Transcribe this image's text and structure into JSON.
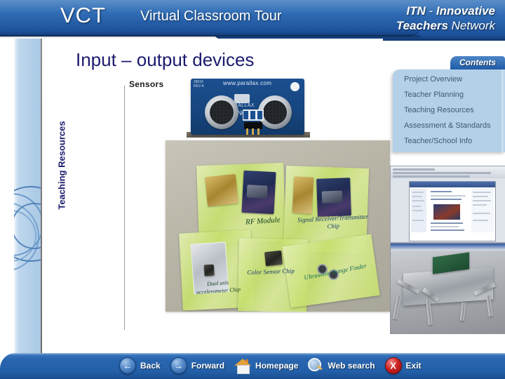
{
  "header": {
    "logo_abbrev": "VCT",
    "logo_full": "Virtual Classroom Tour",
    "brand_line1_bold": "ITN",
    "brand_line1_rest": " - ",
    "brand_line1_italic": "Innovative",
    "brand_line2_bold": "Teachers",
    "brand_line2_rest": " Network"
  },
  "slide": {
    "title": "Input – output devices",
    "subtitle": "Sensors",
    "side_label": "Teaching Resources"
  },
  "sensor_photo": {
    "board_url": "www.parallax.com",
    "board_rev": "28015\nREV A",
    "board_brand": "PARALLAX",
    "board_model": "PING)))"
  },
  "bags_photo": {
    "labels": [
      "RF Module",
      "Signal Receiver/Transmitter Chip",
      "Dual axis accelerometer Chip",
      "Color Sensor Chip",
      "Ultrasonic Range Finder"
    ]
  },
  "contents": {
    "tab_label": "Contents",
    "items": [
      {
        "label": "Project Overview"
      },
      {
        "label": "Teacher Planning"
      },
      {
        "label": "Teaching  Resources"
      },
      {
        "label": "Assessment & Standards"
      },
      {
        "label": "Teacher/School Info"
      }
    ]
  },
  "footer": {
    "nav": [
      {
        "label": "Back",
        "icon": "arrow-left-icon",
        "glyph": "←"
      },
      {
        "label": "Forward",
        "icon": "arrow-right-icon",
        "glyph": "→"
      },
      {
        "label": "Homepage",
        "icon": "house-icon",
        "glyph": ""
      },
      {
        "label": "Web search",
        "icon": "magnifier-icon",
        "glyph": ""
      },
      {
        "label": "Exit",
        "icon": "close-x-icon",
        "glyph": "X"
      }
    ]
  },
  "colors": {
    "header_blue": "#2f6cb5",
    "footer_blue": "#2a66b0",
    "title_navy": "#1b1b6e",
    "panel_blue": "#b3d0e8",
    "band_blue": "#b7d2ea",
    "exit_red": "#cf2424"
  }
}
